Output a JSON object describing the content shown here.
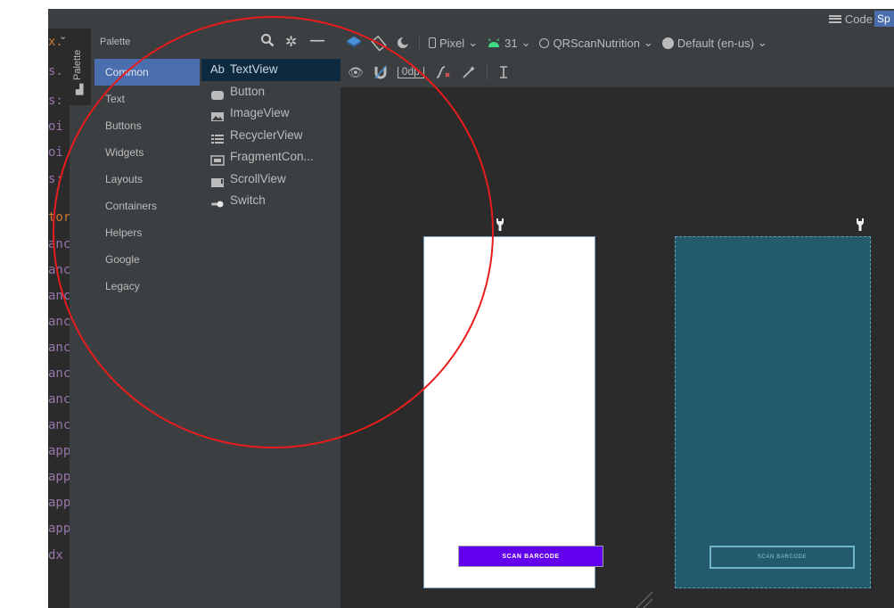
{
  "top_bar": {
    "code_label": "Code",
    "split_label": "Sp"
  },
  "code_gutter": {
    "lines": [
      {
        "text": "x.",
        "color": "#cc7832"
      },
      {
        "text": "s.",
        "color": "#9876aa"
      },
      {
        "text": "s:",
        "color": "#9876aa"
      },
      {
        "text": "oi",
        "color": "#9876aa"
      },
      {
        "text": "oi",
        "color": "#9876aa"
      },
      {
        "text": "s:",
        "color": "#9876aa"
      },
      {
        "text": "tor",
        "color": "#cc7832"
      },
      {
        "text": "anc",
        "color": "#9876aa"
      },
      {
        "text": "anc",
        "color": "#9876aa"
      },
      {
        "text": "anc",
        "color": "#9876aa"
      },
      {
        "text": "anc",
        "color": "#9876aa"
      },
      {
        "text": "anc",
        "color": "#9876aa"
      },
      {
        "text": "anc",
        "color": "#9876aa"
      },
      {
        "text": "anc",
        "color": "#9876aa"
      },
      {
        "text": "anc",
        "color": "#9876aa"
      },
      {
        "text": "app",
        "color": "#9876aa"
      },
      {
        "text": "app",
        "color": "#9876aa"
      },
      {
        "text": "app",
        "color": "#9876aa"
      },
      {
        "text": "app",
        "color": "#9876aa"
      },
      {
        "text": "dx",
        "color": "#9876aa"
      }
    ]
  },
  "side_tab": {
    "label": "Palette"
  },
  "palette": {
    "title": "Palette",
    "categories": [
      {
        "label": "Common",
        "selected": true
      },
      {
        "label": "Text"
      },
      {
        "label": "Buttons"
      },
      {
        "label": "Widgets"
      },
      {
        "label": "Layouts"
      },
      {
        "label": "Containers"
      },
      {
        "label": "Helpers"
      },
      {
        "label": "Google"
      },
      {
        "label": "Legacy"
      }
    ],
    "components": [
      {
        "label": "TextView",
        "icon": "textview-icon",
        "prefix": "Ab",
        "selected": true
      },
      {
        "label": "Button",
        "icon": "button-icon"
      },
      {
        "label": "ImageView",
        "icon": "imageview-icon"
      },
      {
        "label": "RecyclerView",
        "icon": "recyclerview-icon"
      },
      {
        "label": "FragmentCon...",
        "icon": "fragment-container-icon"
      },
      {
        "label": "ScrollView",
        "icon": "scrollview-icon"
      },
      {
        "label": "Switch",
        "icon": "switch-icon"
      }
    ]
  },
  "design_toolbar": {
    "device": "Pixel",
    "api_level": "31",
    "theme": "QRScanNutrition",
    "locale": "Default (en-us)",
    "margin": "0dp"
  },
  "preview": {
    "light_button_label": "SCAN BARCODE",
    "blueprint_button_label": "SCAN BARCODE"
  },
  "colors": {
    "accent_selection": "#4b6eaf",
    "button_purple": "#6200ee",
    "blueprint_bg": "#235b6c",
    "annotation_circle": "#e81c1c",
    "android_green": "#3ddc84"
  }
}
